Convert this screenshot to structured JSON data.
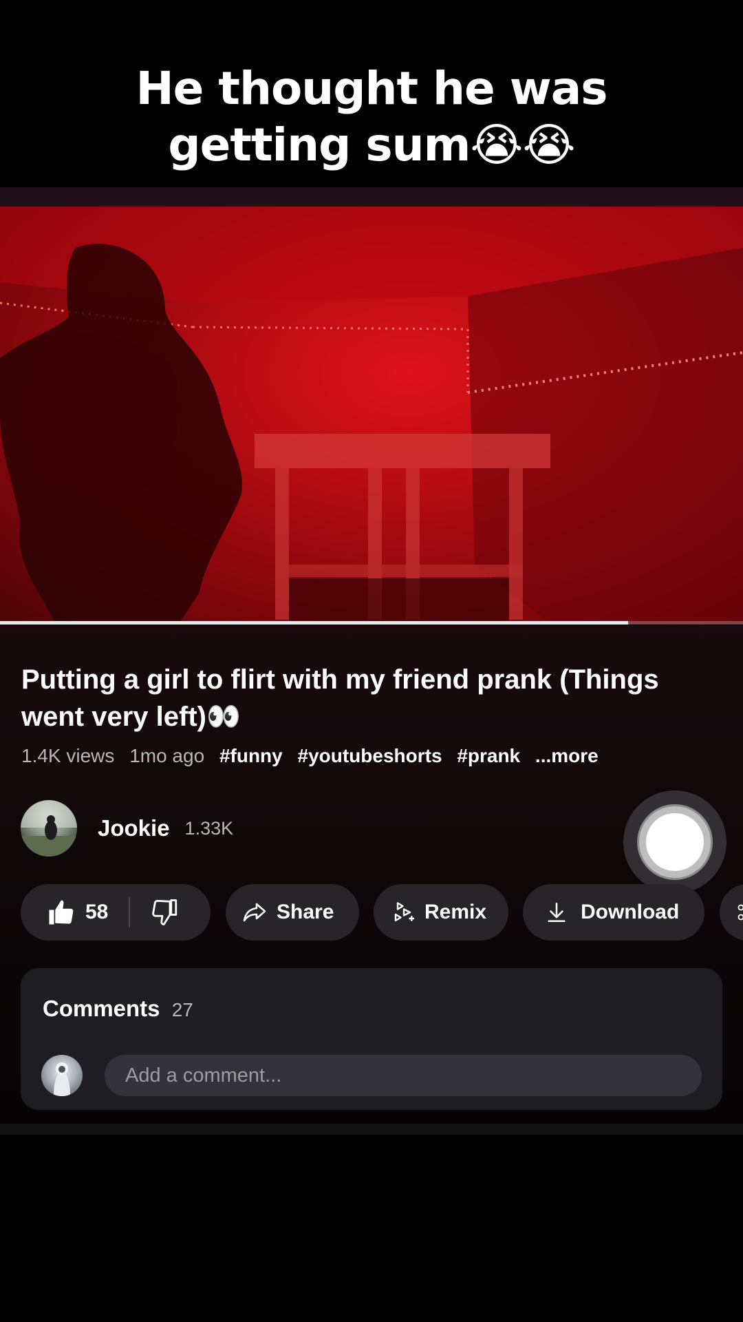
{
  "caption": "He thought he was getting sum😭😭",
  "video": {
    "progress": 0.845
  },
  "title": "Putting a girl to flirt with my friend prank (Things went very left)👀",
  "meta": {
    "views": "1.4K views",
    "age": "1mo ago",
    "tags": [
      "#funny",
      "#youtubeshorts",
      "#prank"
    ],
    "more": "...more"
  },
  "channel": {
    "name": "Jookie",
    "subscribers": "1.33K"
  },
  "actions": {
    "like_count": "58",
    "share_label": "Share",
    "remix_label": "Remix",
    "download_label": "Download"
  },
  "comments": {
    "label": "Comments",
    "count": "27",
    "placeholder": "Add a comment..."
  },
  "icons": {
    "like": "thumbs-up-icon",
    "dislike": "thumbs-down-icon",
    "share": "share-arrow-icon",
    "remix": "remix-icon",
    "download": "download-icon"
  },
  "colors": {
    "video_red": "#c80a12",
    "pill_bg": "#28252a",
    "card_bg": "#1e1d22"
  }
}
